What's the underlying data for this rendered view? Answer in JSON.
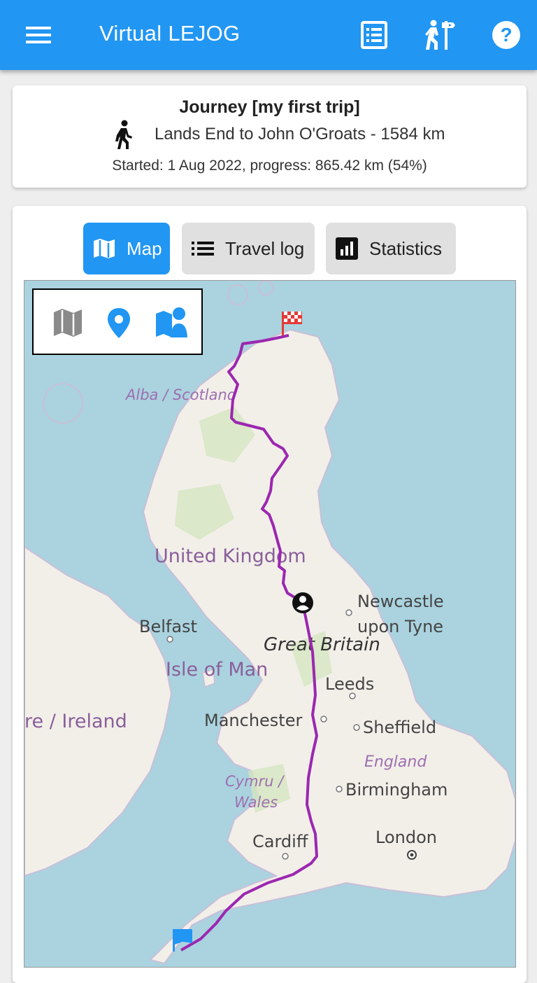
{
  "app": {
    "title": "Virtual LEJOG"
  },
  "toolbar": {
    "menu_icon": "menu-icon",
    "actions": [
      {
        "name": "journal-list-icon"
      },
      {
        "name": "hiker-signpost-icon"
      },
      {
        "name": "help-icon"
      }
    ]
  },
  "journey": {
    "title": "Journey [my first trip]",
    "route": "Lands End to John O'Groats - 1584 km",
    "progress": "Started: 1 Aug 2022, progress: 865.42 km (54%)",
    "progress_fraction": 0.54
  },
  "tabs": [
    {
      "label": "Map",
      "icon": "map-icon",
      "active": true
    },
    {
      "label": "Travel log",
      "icon": "list-icon",
      "active": false
    },
    {
      "label": "Statistics",
      "icon": "bar-chart-icon",
      "active": false
    }
  ],
  "map": {
    "controls": [
      "map-layer-icon",
      "location-pin-icon",
      "map-person-icon"
    ],
    "labels": {
      "scotland": "Alba / Scotland",
      "uk": "United Kingdom",
      "newcastle": "Newcastle",
      "upon_tyne": "upon Tyne",
      "belfast": "Belfast",
      "great_britain": "Great Britain",
      "isle_of_man": "Isle of Man",
      "leeds": "Leeds",
      "ireland": "re / Ireland",
      "manchester": "Manchester",
      "sheffield": "Sheffield",
      "england": "England",
      "cymru": "Cymru /",
      "wales": "Wales",
      "birmingham": "Birmingham",
      "london": "London",
      "cardiff": "Cardiff"
    },
    "colors": {
      "sea": "#aad3df",
      "land": "#f2efe9",
      "route": "#9c27b0",
      "start_flag": "#2196f3",
      "finish_flag": "#e53935"
    }
  }
}
